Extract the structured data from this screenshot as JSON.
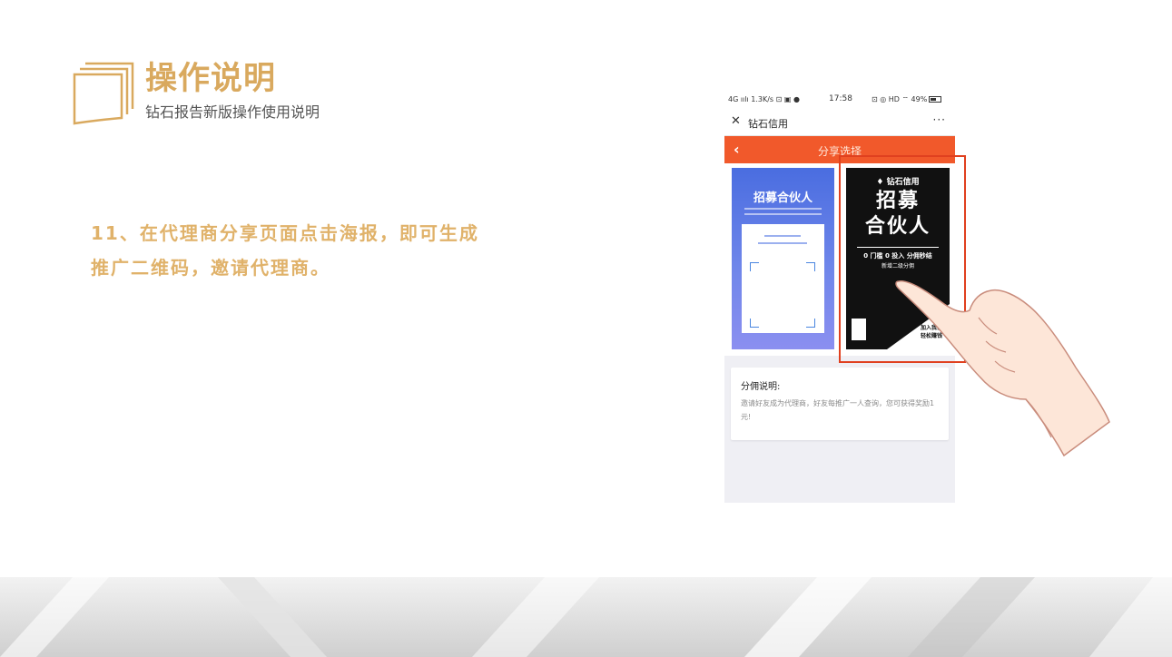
{
  "header": {
    "title": "操作说明",
    "subtitle": "钻石报告新版操作使用说明"
  },
  "instruction": {
    "line1": "11、在代理商分享页面点击海报，即可生成",
    "line2": "推广二维码，邀请代理商。"
  },
  "phone": {
    "status": {
      "left": "4G ıılı 1.3K/s ⊡ ▣ ●",
      "time": "17:58",
      "right": "⊡ ◎ HD ⌔ 49%"
    },
    "wechat": {
      "title": "钻石信用",
      "more": "···"
    },
    "app_bar": {
      "back": "‹",
      "title": "分享选择"
    },
    "poster_blue": {
      "title": "招募合伙人"
    },
    "poster_black": {
      "brand": "♦ 钻石信用",
      "big1": "招募",
      "big2": "合伙人",
      "line1": "0 门槛 0 投入 分佣秒结",
      "line2": "新增二级分佣",
      "tag1": "加入我们",
      "tag2": "轻松赚钱"
    },
    "description": {
      "title": "分佣说明:",
      "body": "邀请好友成为代理商，好友每推广一人查询，您可获得奖励1元!"
    }
  },
  "colors": {
    "title": "#d9a95e",
    "instruction": "#e0b26a",
    "app_bar": "#f1592b",
    "highlight": "#e0401f"
  }
}
